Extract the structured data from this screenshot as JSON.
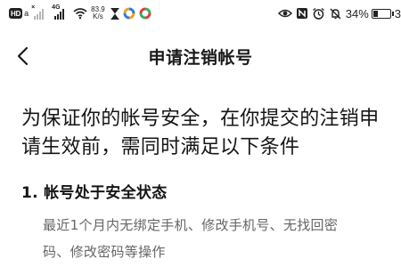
{
  "status_bar": {
    "hd_badge": "HD",
    "sim_mark": "a",
    "signal1_label": "×",
    "signal2_label": "4G",
    "net_speed_value": "83.9",
    "net_speed_unit": "K/s",
    "battery_percent": "34%",
    "battery_level": 0.34,
    "clock_partial": "3"
  },
  "nav": {
    "back_icon": "chevron-left-icon",
    "title": "申请注销帐号"
  },
  "content": {
    "headline_line1": "为保证你的帐号安全，在你提交的注销申",
    "headline_line2": "请生效前，需同时满足以下条件",
    "section1_title": "1. 帐号处于安全状态",
    "section1_desc_line1": "最近1个月内无绑定手机、修改手机号、无找回密",
    "section1_desc_line2": "码、修改密码等操作"
  },
  "colors": {
    "background": "#ffffff",
    "text_primary": "#151515",
    "text_secondary": "#666666"
  }
}
